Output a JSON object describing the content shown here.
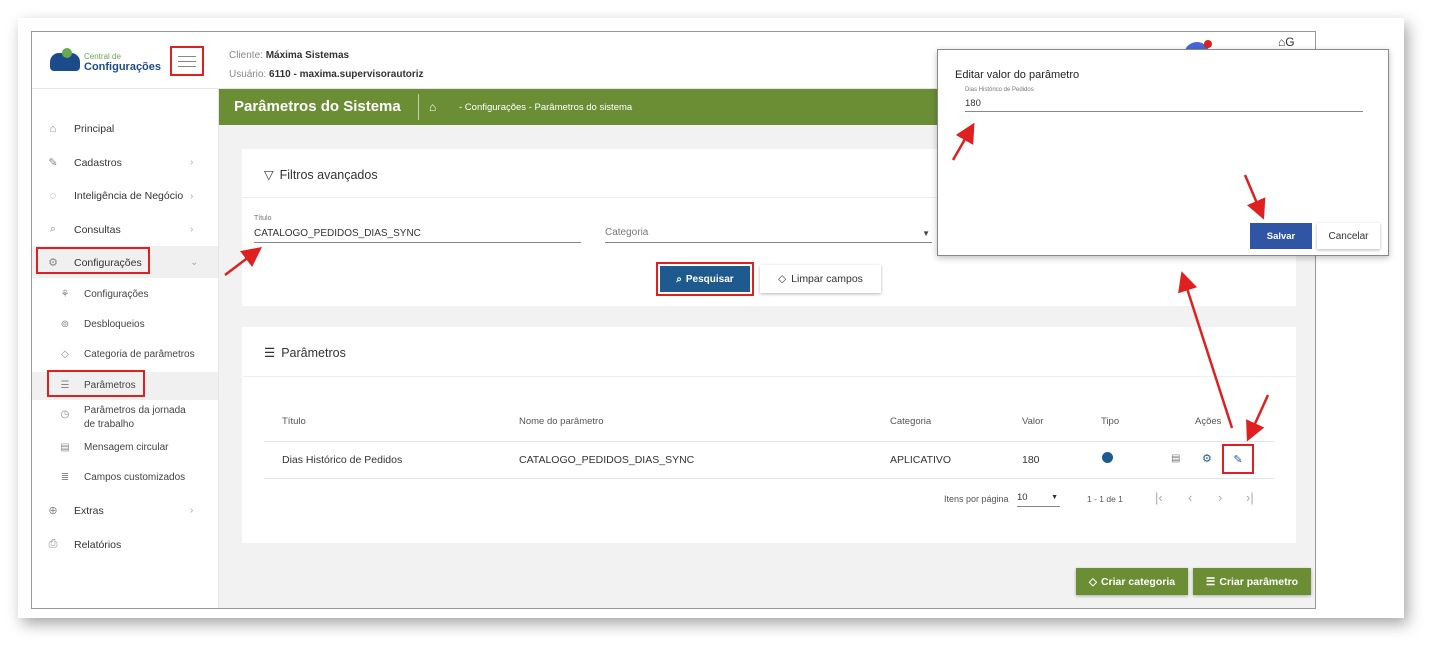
{
  "logo": {
    "small": "Central de",
    "big": "Configurações"
  },
  "header": {
    "client_label": "Cliente:",
    "client_value": "Máxima Sistemas",
    "user_label": "Usuário:",
    "user_value": "6110 - maxima.supervisorautoriz",
    "top_icons": "⌂G"
  },
  "sidebar": {
    "items": [
      {
        "label": "Principal",
        "icon": "⌂"
      },
      {
        "label": "Cadastros",
        "icon": "✎"
      },
      {
        "label": "Inteligência de Negócio",
        "icon": "◌"
      },
      {
        "label": "Consultas",
        "icon": "⌕"
      },
      {
        "label": "Configurações",
        "icon": "⚙"
      },
      {
        "label": "Extras",
        "icon": "⊕"
      },
      {
        "label": "Relatórios",
        "icon": "⎙"
      }
    ],
    "subitems": [
      {
        "label": "Configurações",
        "icon": "⚘"
      },
      {
        "label": "Desbloqueios",
        "icon": "⊚"
      },
      {
        "label": "Categoria de parâmetros",
        "icon": "◇"
      },
      {
        "label": "Parâmetros",
        "icon": "☰"
      },
      {
        "label": "Parâmetros da jornada de trabalho",
        "icon": "◷"
      },
      {
        "label": "Mensagem circular",
        "icon": "▤"
      },
      {
        "label": "Campos customizados",
        "icon": "≣"
      }
    ],
    "chevron": "›",
    "chevron_open": "⌄"
  },
  "greenbar": {
    "title": "Parâmetros do Sistema",
    "home_icon": "⌂",
    "breadcrumb": "- Configurações - Parâmetros do sistema"
  },
  "filters": {
    "title": "Filtros avançados",
    "titulo_label": "Título",
    "titulo_value": "CATALOGO_PEDIDOS_DIAS_SYNC",
    "categoria_placeholder": "Categoria",
    "search_button": "Pesquisar",
    "clear_button": "Limpar campos"
  },
  "params": {
    "title": "Parâmetros",
    "columns": [
      "Título",
      "Nome do parâmetro",
      "Categoria",
      "Valor",
      "Tipo",
      "Ações"
    ],
    "rows": [
      {
        "titulo": "Dias Histórico de Pedidos",
        "nome": "CATALOGO_PEDIDOS_DIAS_SYNC",
        "categoria": "APLICATIVO",
        "valor": "180"
      }
    ],
    "pager": {
      "label": "Itens por página",
      "page_size": "10",
      "range": "1 - 1 de 1"
    }
  },
  "actions": {
    "create_category": "Criar categoria",
    "create_param": "Criar parâmetro"
  },
  "dialog": {
    "title": "Editar valor do parâmetro",
    "field_label": "Dias Histórico de Pedidos",
    "field_value": "180",
    "save": "Salvar",
    "cancel": "Cancelar"
  },
  "colors": {
    "accent_green": "#6b8e35",
    "primary_blue": "#1f5a8e",
    "highlight_red": "#e02020",
    "save_blue": "#2f55a4"
  }
}
